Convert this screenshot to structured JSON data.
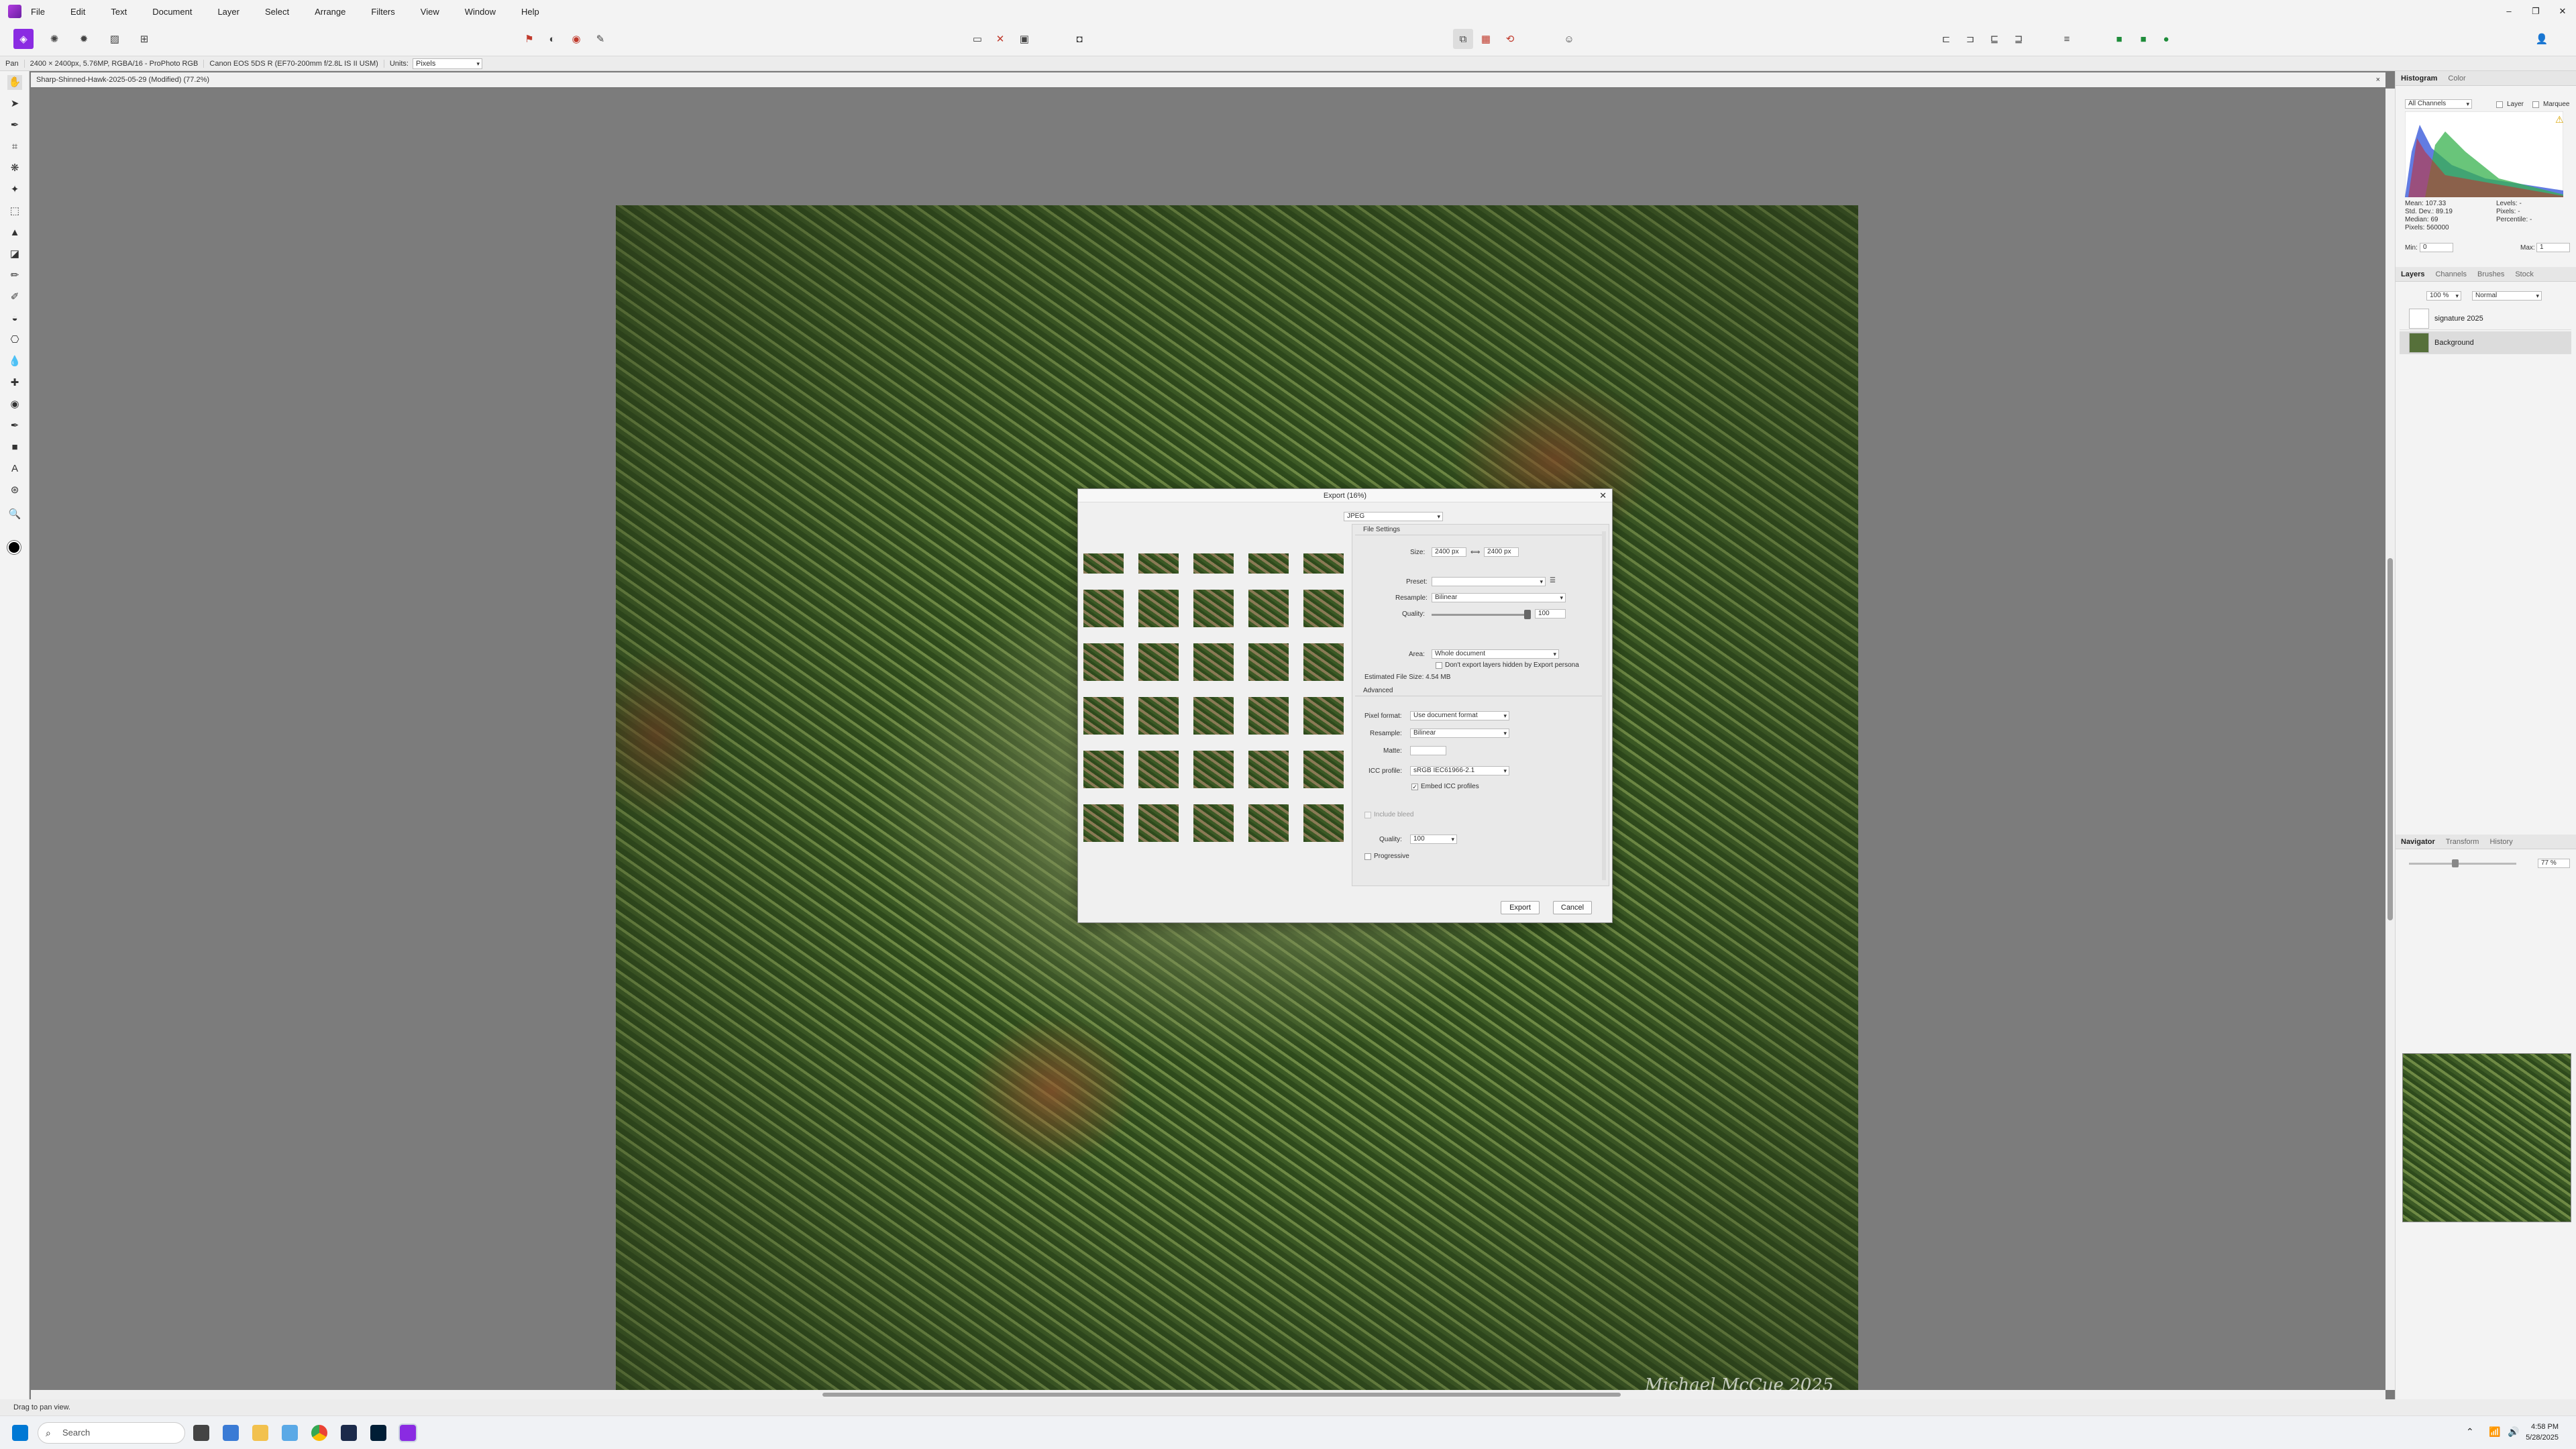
{
  "menu": [
    "File",
    "Edit",
    "Text",
    "Document",
    "Layer",
    "Select",
    "Arrange",
    "Filters",
    "View",
    "Window",
    "Help"
  ],
  "context": {
    "tool": "Pan",
    "doc_info": "2400 × 2400px, 5.76MP, RGBA/16 - ProPhoto RGB",
    "lens": "Canon EOS 5DS R (EF70-200mm f/2.8L IS II USM)",
    "units_label": "Units:",
    "units_value": "Pixels"
  },
  "doc_tab": {
    "title": "Sharp-Shinned-Hawk-2025-05-29 (Modified) (77.2%)",
    "close": "×"
  },
  "photo": {
    "signature": "Michael McCue 2025"
  },
  "status": {
    "text": "Drag to pan view."
  },
  "histogram_panel": {
    "tabs": [
      "Histogram",
      "Color"
    ],
    "channel": "All Channels",
    "opt_layer": "Layer",
    "opt_marquee": "Marquee",
    "mean": "Mean: 107.33",
    "std": "Std. Dev.: 89.19",
    "median": "Median: 69",
    "pixels": "Pixels: 560000",
    "levels": "Levels: -",
    "pixels_r": "Pixels: -",
    "percentile": "Percentile: -",
    "min_label": "Min:",
    "min_val": "0",
    "max_label": "Max:",
    "max_val": "1"
  },
  "layers_panel": {
    "tabs": [
      "Layers",
      "Channels",
      "Brushes",
      "Stock"
    ],
    "opacity": "100 %",
    "blend": "Normal",
    "layers": [
      {
        "name": "signature 2025"
      },
      {
        "name": "Background"
      }
    ]
  },
  "navigator_panel": {
    "tabs": [
      "Navigator",
      "Transform",
      "History"
    ],
    "zoom": "77 %"
  },
  "dialog": {
    "title": "Export (16%)",
    "format": "JPEG",
    "file_settings": "File Settings",
    "size_label": "Size:",
    "width": "2400 px",
    "height": "2400 px",
    "preset_label": "Preset:",
    "preset": "",
    "resample_label": "Resample:",
    "resample": "Bilinear",
    "quality_label": "Quality:",
    "quality": "100",
    "area_label": "Area:",
    "area": "Whole document",
    "hidden_label": "Don't export layers hidden by Export persona",
    "est_size": "Estimated File Size: 4.54 MB",
    "advanced": "Advanced",
    "pixel_format_label": "Pixel format:",
    "pixel_format": "Use document format",
    "resample2_label": "Resample:",
    "resample2": "Bilinear",
    "matte_label": "Matte:",
    "icc_label": "ICC profile:",
    "icc": "sRGB IEC61966-2.1",
    "embed_icc": "Embed ICC profiles",
    "include_bleed": "Include bleed",
    "quality2_label": "Quality:",
    "quality2": "100",
    "progressive": "Progressive",
    "export_btn": "Export",
    "cancel_btn": "Cancel"
  },
  "taskbar": {
    "search": "Search",
    "time": "4:58 PM",
    "date": "5/28/2025"
  }
}
